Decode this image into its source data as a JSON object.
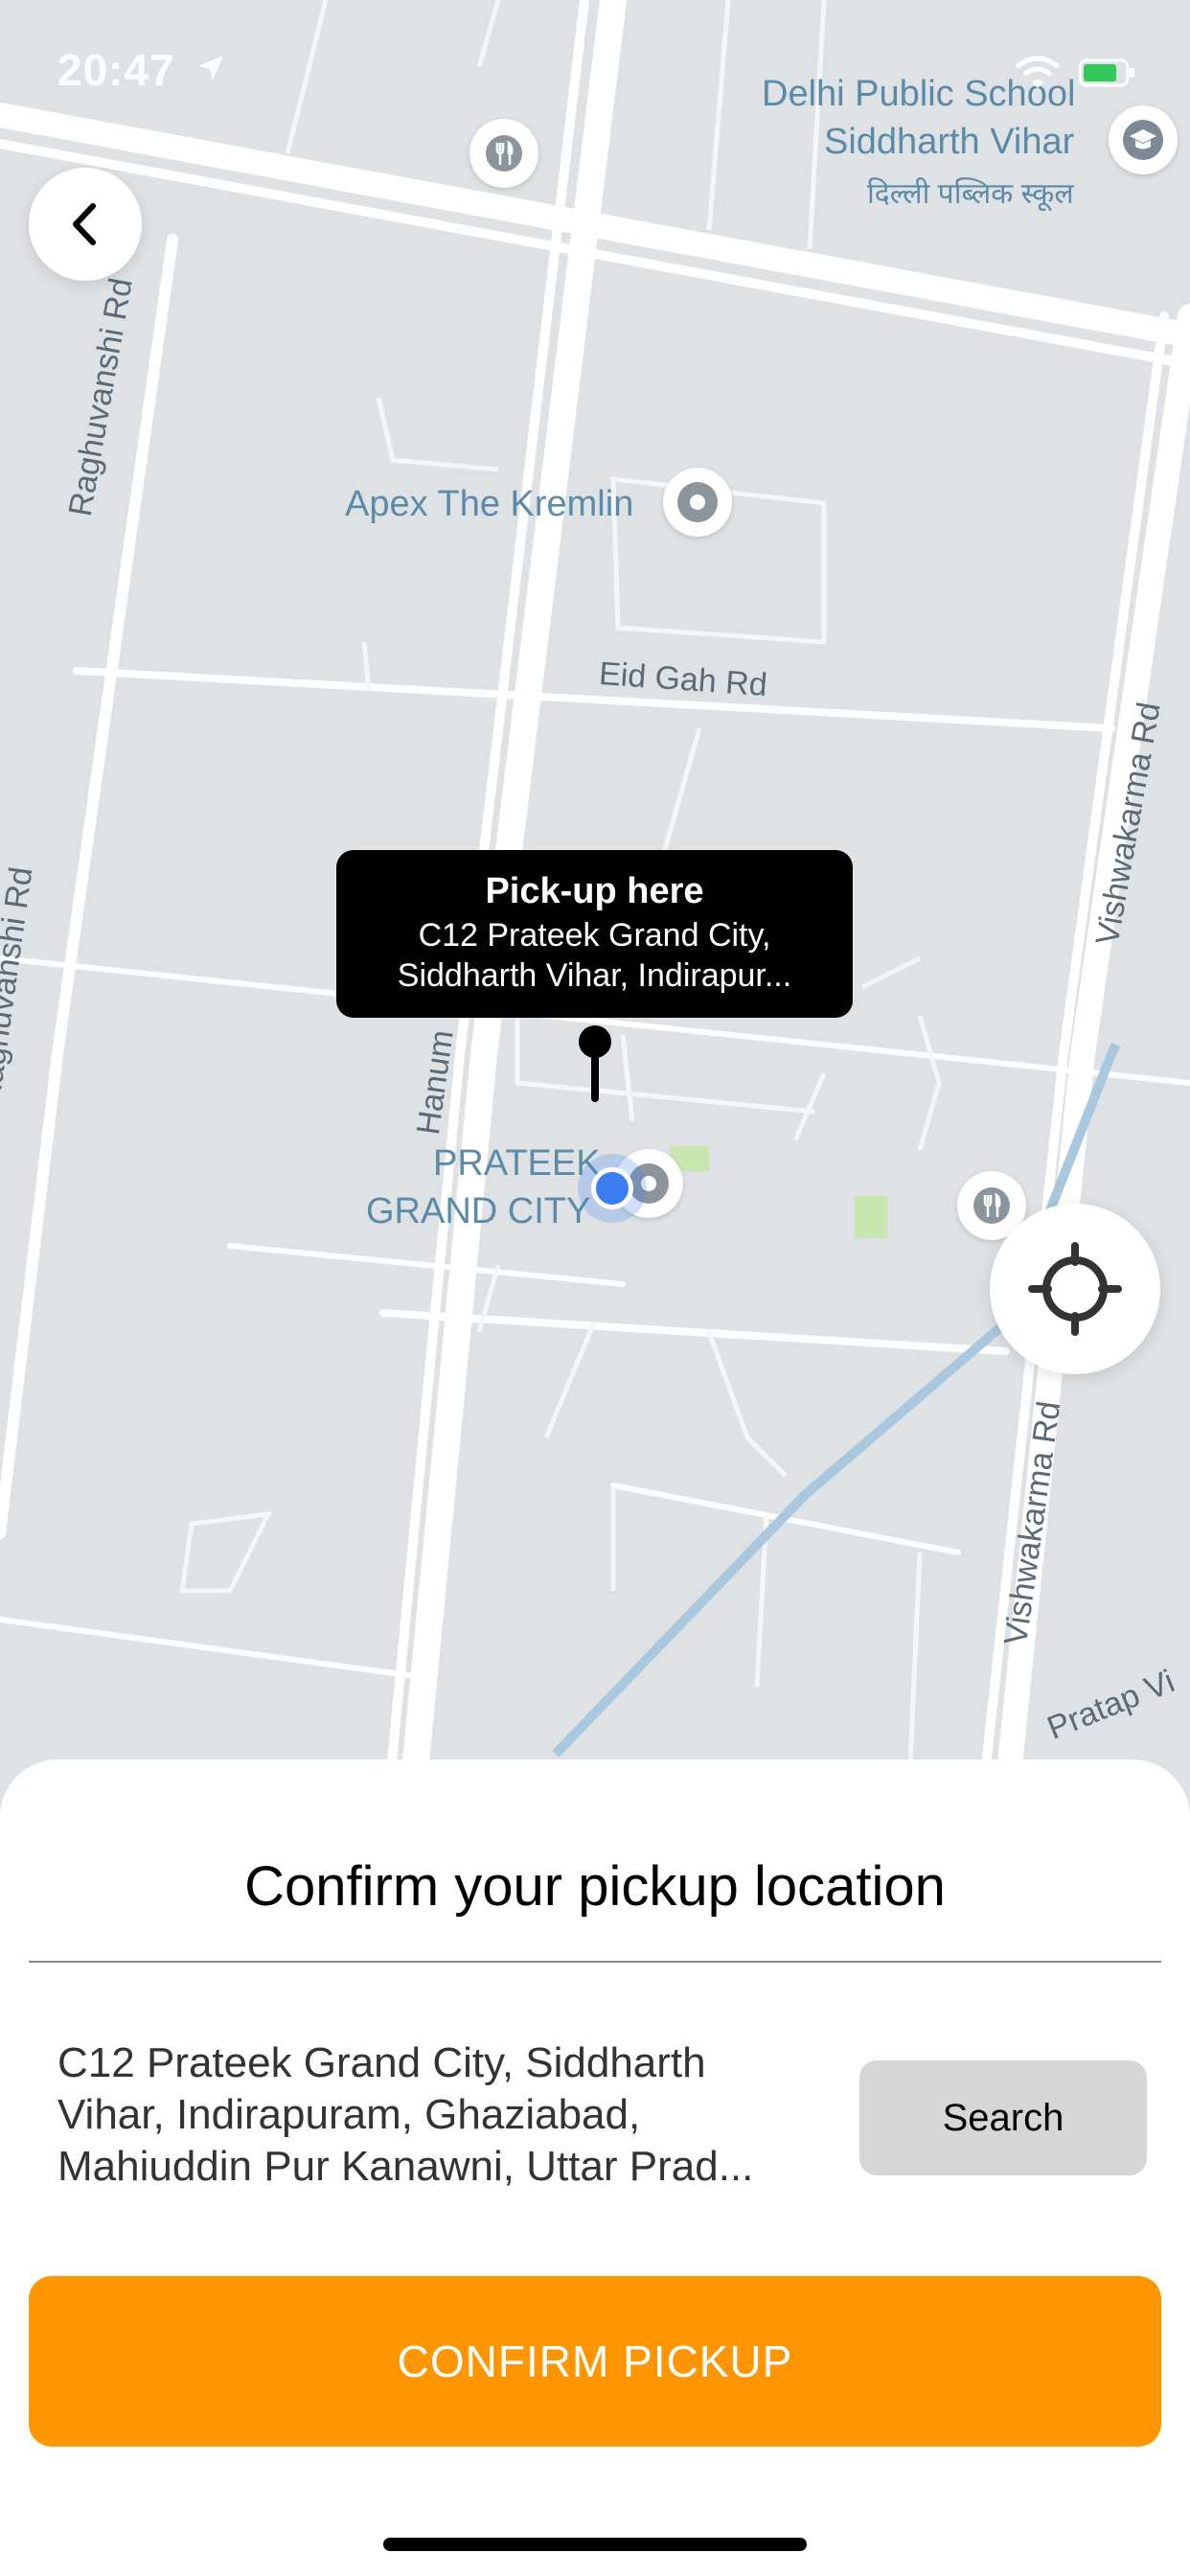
{
  "status_bar": {
    "time": "20:47"
  },
  "map": {
    "labels": {
      "school_en_1": "Delhi Public School",
      "school_en_2": "Siddharth Vihar",
      "school_hi": "दिल्ली पब्लिक स्कूल",
      "apex": "Apex The Kremlin",
      "eid_gah": "Eid Gah Rd",
      "raghuvanshi_top": "Raghuvanshi Rd",
      "raghuvanshi_bottom": "Raghuvanshi Rd",
      "vishwakarma_top": "Vishwakarma Rd",
      "vishwakarma_bottom": "Vishwakarma Rd",
      "hanuman": "Hanum",
      "prateek_1": "PRATEEK",
      "prateek_2": "GRAND CITY",
      "pratap": "Pratap Vi"
    },
    "callout": {
      "title": "Pick-up here",
      "address_line1": "C12 Prateek Grand City,",
      "address_line2": "Siddharth Vihar, Indirapur..."
    }
  },
  "sheet": {
    "title": "Confirm your pickup location",
    "address_line1": "C12 Prateek Grand City, Siddharth",
    "address_line2": "Vihar, Indirapuram, Ghaziabad,",
    "address_line3": "Mahiuddin Pur Kanawni, Uttar Prad...",
    "search_label": "Search",
    "confirm_label": "CONFIRM PICKUP"
  },
  "colors": {
    "accent": "#ff9500",
    "user_location": "#3c7ef0",
    "map_bg": "#dee2e5"
  },
  "icons": [
    "back-chevron-icon",
    "locate-crosshair-icon",
    "restaurant-icon",
    "school-icon",
    "place-pin-icon",
    "wifi-icon",
    "battery-icon",
    "location-arrow-icon"
  ]
}
